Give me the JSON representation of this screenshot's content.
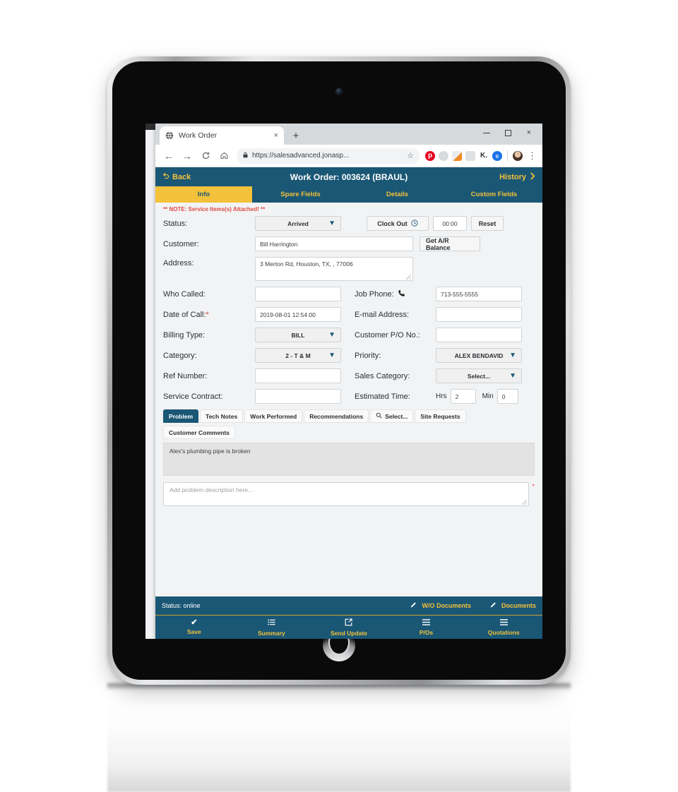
{
  "browser": {
    "tab": {
      "title": "Work Order",
      "favicon": "globe-icon",
      "close": "×"
    },
    "new_tab_label": "+",
    "window_controls": {
      "minimize": "–",
      "maximize": "□",
      "close": "×"
    },
    "nav": {
      "back": "←",
      "forward": "→",
      "reload": "C",
      "home": "⌂"
    },
    "omnibox": {
      "lock": "🔒",
      "url": "https://salesadvanced.jonasp...",
      "star": "☆"
    },
    "extensions": [
      "pinterest-icon",
      "circle-icon",
      "document-icon",
      "gray-icon",
      "k-icon",
      "blue-circle-icon"
    ],
    "profile": "avatar",
    "menu": "⋮"
  },
  "app": {
    "header": {
      "back_label": "Back",
      "back_icon": "undo-arrow-icon",
      "title": "Work Order: 003624   (BRAUL)",
      "history_label": "History",
      "history_icon": "chevron-right-icon"
    },
    "tabs": [
      {
        "label": "Info",
        "active": true
      },
      {
        "label": "Spare Fields",
        "active": false
      },
      {
        "label": "Details",
        "active": false
      },
      {
        "label": "Custom Fields",
        "active": false
      }
    ],
    "note": "** NOTE: Service Items(s) Attached! **",
    "fields": {
      "status_label": "Status:",
      "status_value": "Arrived",
      "clock_out_label": "Clock Out",
      "clock_out_icon": "clock-icon",
      "clock_time": "00:00",
      "reset_label": "Reset",
      "customer_label": "Customer:",
      "customer_value": "Bill Harrington",
      "ar_balance_label": "Get A/R Balance",
      "address_label": "Address:",
      "address_value": "3 Merton Rd, Houston, TX, , 77006",
      "who_called_label": "Who Called:",
      "who_called_value": "",
      "job_phone_label": "Job Phone:",
      "job_phone_icon": "phone-icon",
      "job_phone_value": "713-555-5555",
      "date_of_call_label": "Date of Call:",
      "date_of_call_required": "*",
      "date_of_call_value": "2019-08-01 12:54:00",
      "email_label": "E-mail Address:",
      "email_value": "",
      "billing_type_label": "Billing Type:",
      "billing_type_value": "BILL",
      "customer_po_label": "Customer P/O No.:",
      "customer_po_value": "",
      "category_label": "Category:",
      "category_value": "2 - T & M",
      "priority_label": "Priority:",
      "priority_value": "ALEX BENDAVID",
      "ref_number_label": "Ref Number:",
      "ref_number_value": "",
      "sales_category_label": "Sales Category:",
      "sales_category_value": "Select...",
      "service_contract_label": "Service Contract:",
      "service_contract_value": "",
      "estimated_time_label": "Estimated Time:",
      "hrs_label": "Hrs",
      "hrs_value": "2",
      "min_label": "Min",
      "min_value": "0"
    },
    "subtabs": [
      {
        "label": "Problem",
        "active": true,
        "icon": ""
      },
      {
        "label": "Tech Notes",
        "active": false,
        "icon": ""
      },
      {
        "label": "Work Performed",
        "active": false,
        "icon": ""
      },
      {
        "label": "Recommendations",
        "active": false,
        "icon": ""
      },
      {
        "label": "Select...",
        "active": false,
        "icon": "search-icon"
      },
      {
        "label": "Site Requests",
        "active": false,
        "icon": ""
      },
      {
        "label": "Customer Comments",
        "active": false,
        "icon": ""
      }
    ],
    "comment_text": "Alex's plumbing pipe is broken",
    "description_placeholder": "Add problem description here...",
    "description_required": "*",
    "statusbar": {
      "status_text": "Status: online",
      "wo_documents_label": "W/O Documents",
      "documents_label": "Documents",
      "pencil_icon": "pencil-icon"
    },
    "bottombar": [
      {
        "label": "Save",
        "icon": "check-icon",
        "glyph": "✔"
      },
      {
        "label": "Summary",
        "icon": "list-icon",
        "glyph": "☰"
      },
      {
        "label": "Send Update",
        "icon": "share-icon",
        "glyph": "⇱"
      },
      {
        "label": "P/Os",
        "icon": "menu-icon",
        "glyph": "☰"
      },
      {
        "label": "Quotations",
        "icon": "menu-icon",
        "glyph": "☰"
      }
    ]
  },
  "colors": {
    "header_blue": "#1a5775",
    "accent_yellow": "#f3c13a",
    "alert_red": "#e04a42",
    "form_bg": "#f2f3f4"
  }
}
